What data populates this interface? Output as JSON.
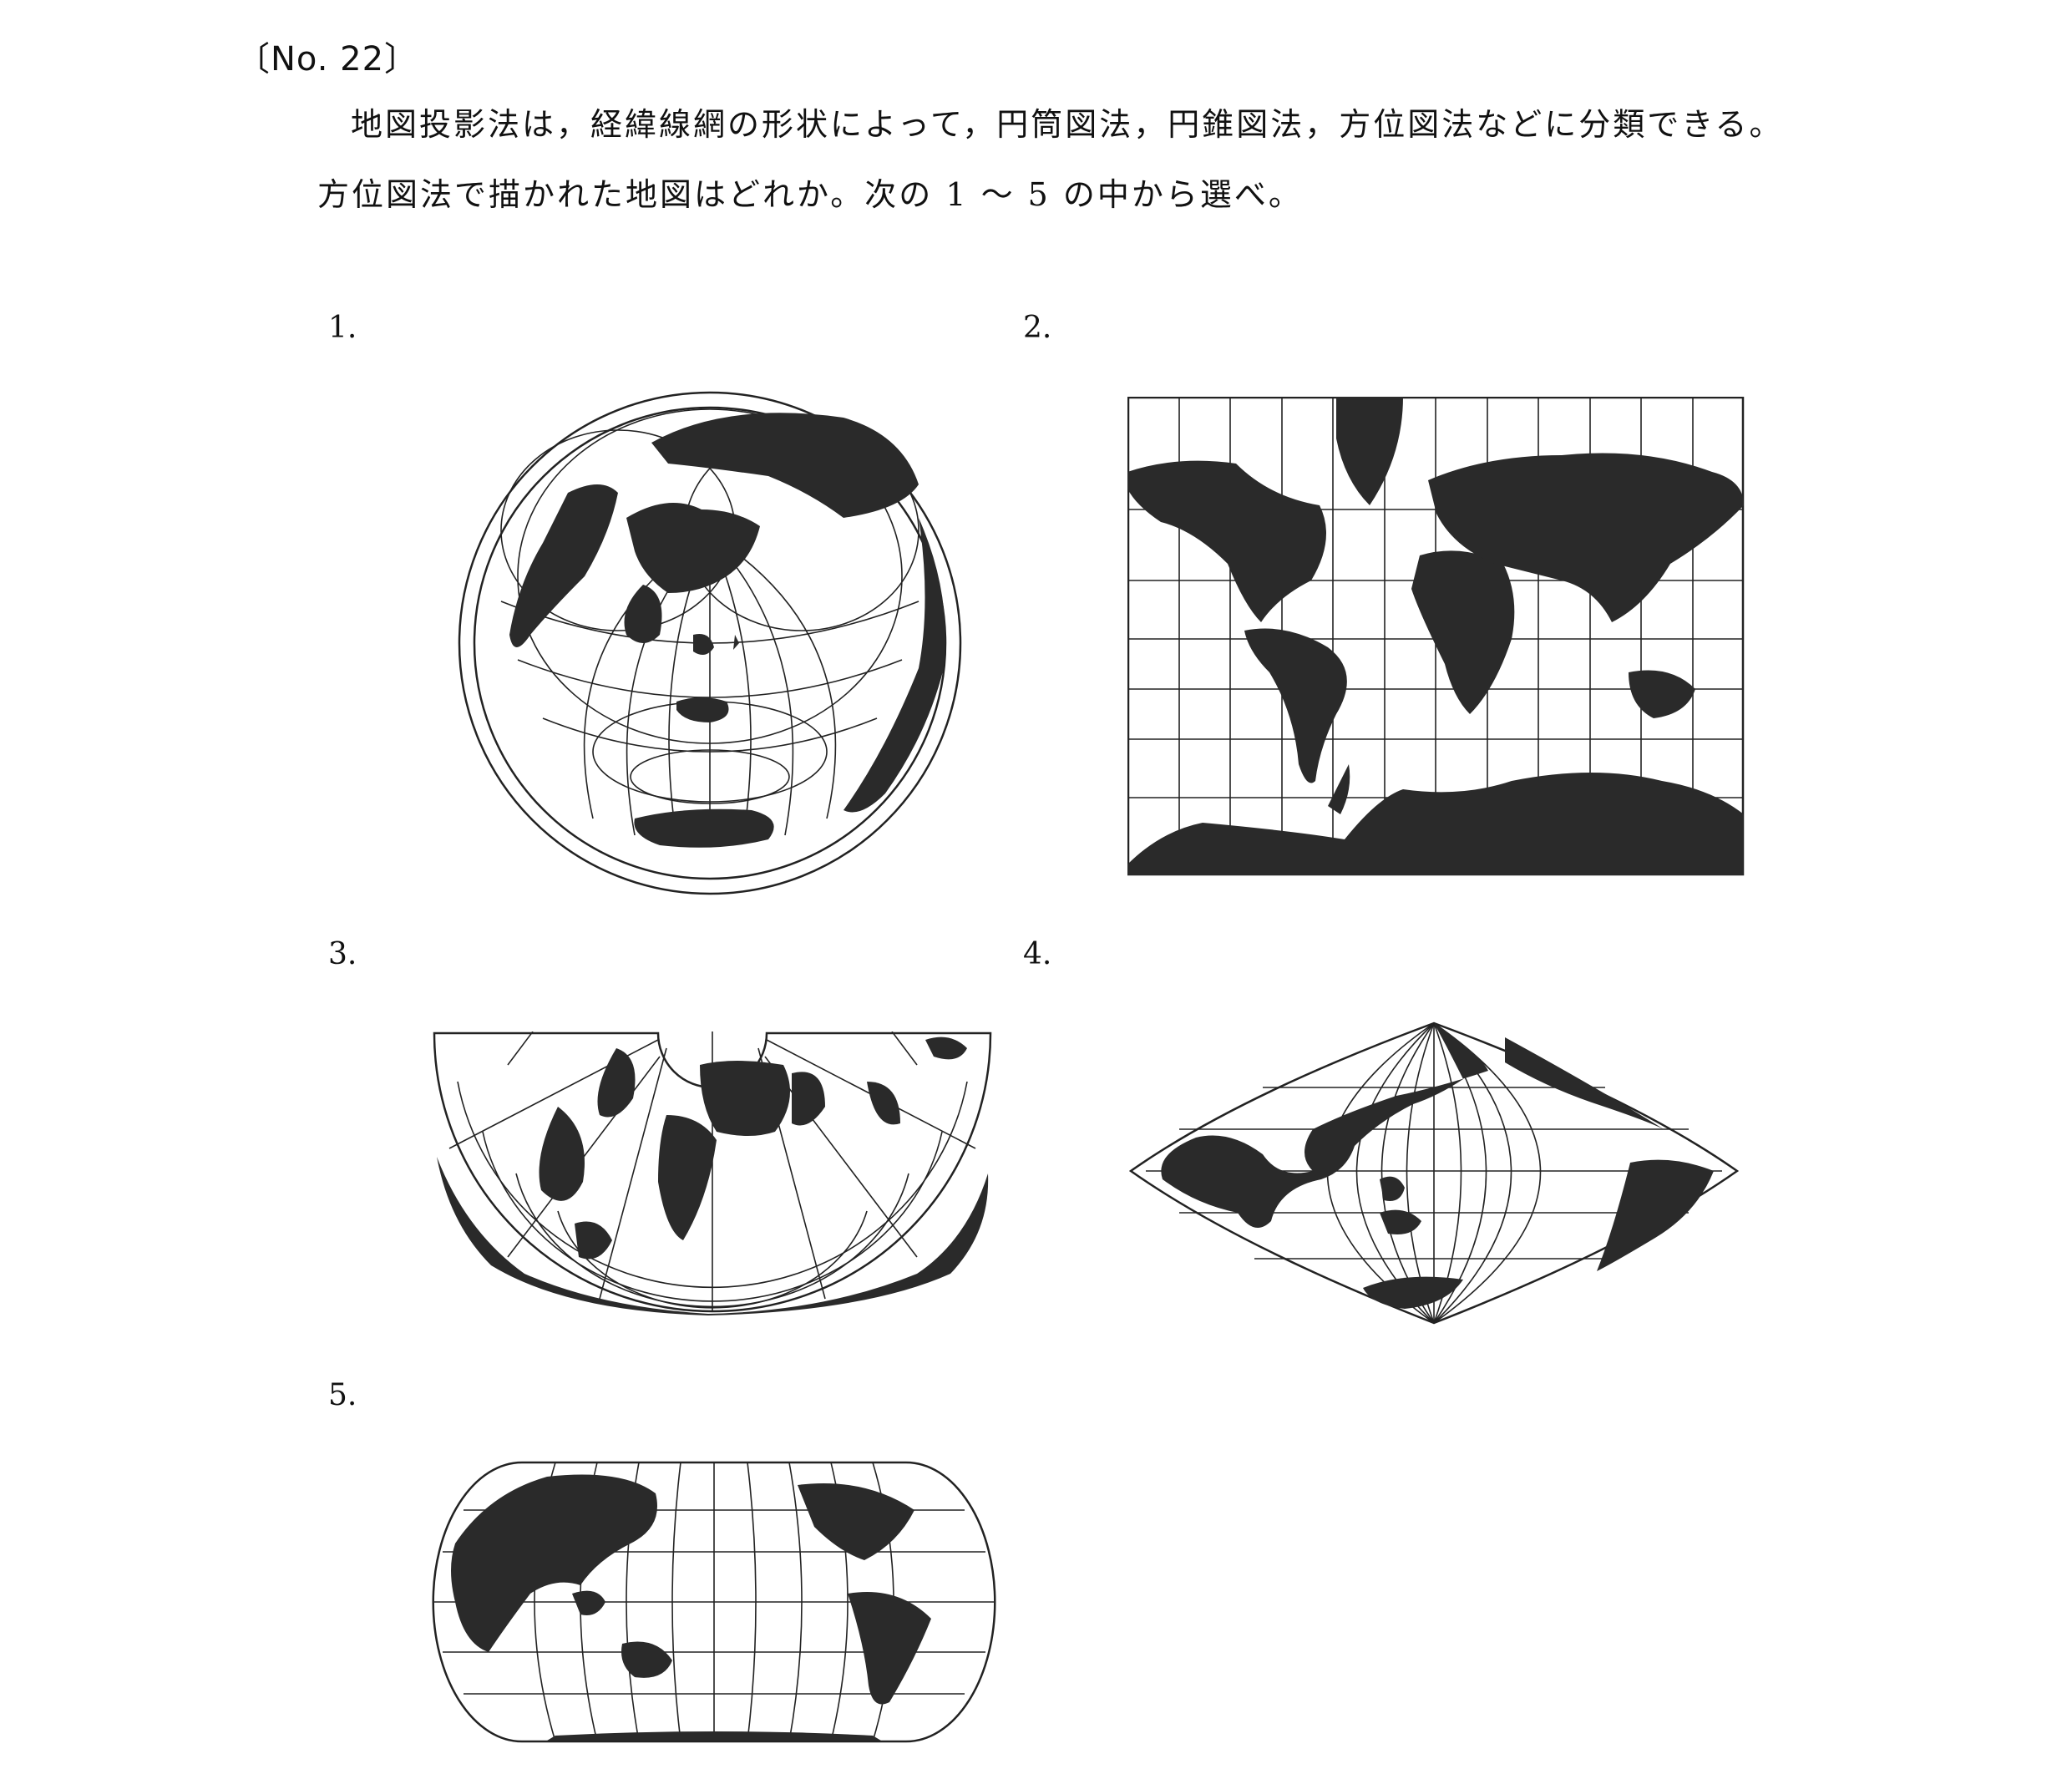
{
  "question": {
    "number": "〔No. 22〕",
    "line1": "地図投影法は，経緯線網の形状によって，円筒図法，円錐図法，方位図法などに分類できる。",
    "line2": "方位図法で描かれた地図はどれか。次の 1 〜 5 の中から選べ。"
  },
  "options": [
    {
      "label": "1.",
      "map": "azimuthal-world-map"
    },
    {
      "label": "2.",
      "map": "cylindrical-world-map"
    },
    {
      "label": "3.",
      "map": "conic-world-map"
    },
    {
      "label": "4.",
      "map": "sinusoidal-world-map"
    },
    {
      "label": "5.",
      "map": "pseudocylindrical-world-map"
    }
  ],
  "colors": {
    "land": "#2a2a2a",
    "grid": "#222222",
    "background": "#ffffff"
  }
}
